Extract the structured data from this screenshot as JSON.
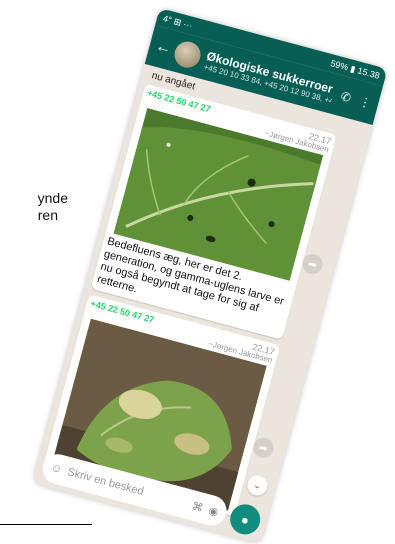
{
  "page_fragment": {
    "line1": "ynde",
    "line2": "ren"
  },
  "status_bar": {
    "left": "4° ⊞ ···",
    "right": "59% ▮ 15.38"
  },
  "header": {
    "title": "Økologiske sukkerroer",
    "subtitle": "+45 20 10 33 84, +45 20 12 90 38, +45 20 ..."
  },
  "chat": {
    "previous_text": "nu angået",
    "messages": [
      {
        "sender": "+45 22 50 47 27",
        "time": "22.17",
        "alias": "~Jørgen Jakobsen",
        "caption": "Bedefluens æg, her er det 2. generation, og gamma-uglens larve er nu også begyndt at tage for sig af retterne."
      },
      {
        "sender": "+45 22 50 47 27",
        "time": "22.17",
        "alias": "~Jørgen Jakobsen"
      }
    ]
  },
  "input": {
    "placeholder": "Skriv en besked"
  },
  "icons": {
    "back": "arrow-left-icon",
    "call": "add-call-icon",
    "menu": "more-vertical-icon",
    "emoji": "emoji-icon",
    "attach": "paperclip-icon",
    "camera": "camera-icon",
    "mic": "microphone-icon",
    "forward": "forward-icon",
    "scroll": "chevrons-down-icon"
  },
  "colors": {
    "header": "#075e54",
    "accent": "#128c7e",
    "sender": "#25d366",
    "chat_background": "#ece5dd"
  }
}
